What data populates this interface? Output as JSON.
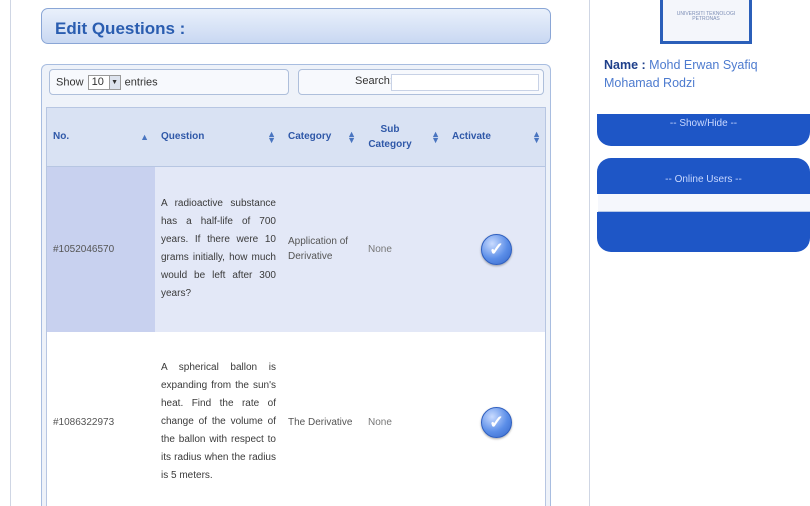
{
  "header": {
    "title": "Edit Questions :"
  },
  "controls": {
    "show_label": "Show",
    "entries_value": "10",
    "entries_label": "entries",
    "search_label": "Search:",
    "search_value": ""
  },
  "table": {
    "columns": [
      "No.",
      "Question",
      "Category",
      "Sub Category",
      "Activate"
    ],
    "rows": [
      {
        "no": "#1052046570",
        "question": "A radioactive substance has a half-life of 700 years. If there were 10 grams initially, how much would be left after 300 years?",
        "category": "Application of Derivative",
        "sub_category": "None",
        "activate_icon": "check-circle-icon"
      },
      {
        "no": "#1086322973",
        "question": "A spherical ballon is expanding from the sun's heat. Find the rate of change of the volume of the ballon with respect to its radius when the radius is 5 meters.",
        "category": "The Derivative",
        "sub_category": "None",
        "activate_icon": "check-circle-icon"
      }
    ]
  },
  "sidebar": {
    "name_label": "Name :",
    "name_value": "Mohd Erwan Syafiq Mohamad Rodzi",
    "showhide_label": "-- Show/Hide --",
    "online_label": "-- Online Users --",
    "logo_text": "UNIVERSITI TEKNOLOGI PETRONAS"
  },
  "colors": {
    "accent": "#1e56c6",
    "header_text": "#2a5db0",
    "row_highlight": "#e3e8f7"
  }
}
